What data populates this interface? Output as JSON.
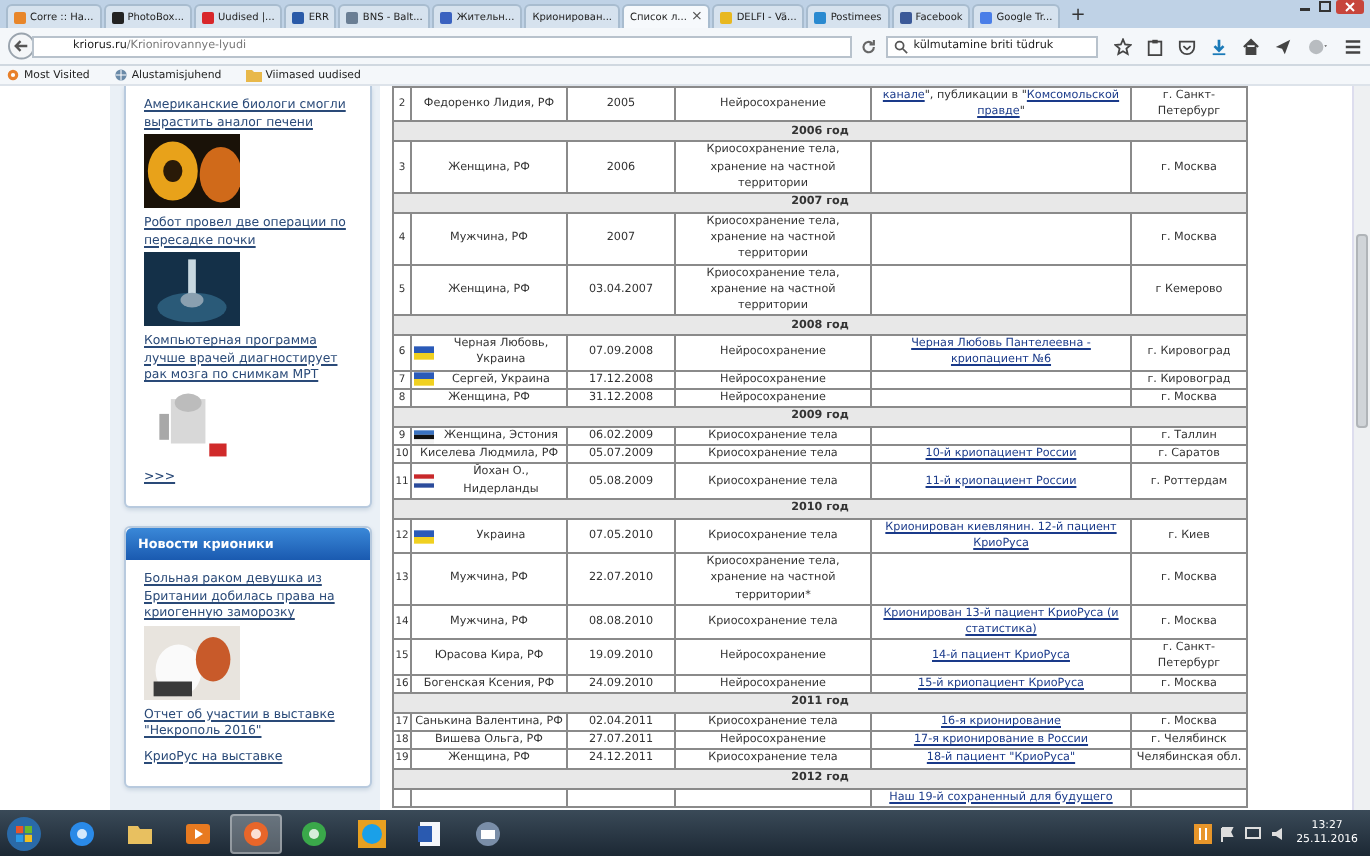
{
  "tabs": [
    {
      "label": "Corre :: На...",
      "selected": false,
      "color": "#e8862a"
    },
    {
      "label": "PhotoBox...",
      "selected": false,
      "color": "#222222"
    },
    {
      "label": "Uudised |...",
      "selected": false,
      "color": "#d8262a"
    },
    {
      "label": "ERR",
      "selected": false,
      "color": "#2a5aa8"
    },
    {
      "label": "BNS - Balt...",
      "selected": false,
      "color": "#6a7e94"
    },
    {
      "label": "Жительн...",
      "selected": false,
      "color": "#3a62c0"
    },
    {
      "label": "Крионирован...",
      "selected": false
    },
    {
      "label": "Список л...",
      "selected": true
    },
    {
      "label": "DELFI - Vä...",
      "selected": false,
      "color": "#e8b820"
    },
    {
      "label": "Postimees",
      "selected": false,
      "color": "#2a8ad0"
    },
    {
      "label": "Facebook",
      "selected": false,
      "color": "#3b5998"
    },
    {
      "label": "Google Tr...",
      "selected": false,
      "color": "#4a7ee8"
    }
  ],
  "tab_close": "×",
  "new_tab": "+",
  "address": {
    "host": "kriorus.ru",
    "path": "/Krionirovannye-lyudi"
  },
  "search": {
    "value": "külmutamine briti tüdruk"
  },
  "bookmarks": [
    {
      "label": "Most Visited",
      "kind": "gear"
    },
    {
      "label": "Alustamisjuhend",
      "kind": "globe"
    },
    {
      "label": "Viimased uudised",
      "kind": "folder"
    }
  ],
  "sidebar": {
    "panels": [
      {
        "items": [
          {
            "text": "Американские биологи смогли вырастить аналог печени",
            "picture": true
          },
          {
            "text": "Робот провел две операции по пересадке почки",
            "picture": true
          },
          {
            "text": "Компьютерная программа лучше врачей диагностирует рак мозга по снимкам МРТ",
            "picture": true
          },
          {
            "text": ">>>",
            "picture": false
          }
        ]
      },
      {
        "title": "Новости крионики",
        "items": [
          {
            "text": "Больная раком девушка из Британии добилась права на криогенную заморозку",
            "picture": true
          },
          {
            "text": "Отчет об участии в выставке \"Некрополь 2016\"",
            "picture": false
          },
          {
            "text": "КриоРус на выставке",
            "picture": false
          }
        ]
      }
    ]
  },
  "table": {
    "rows": [
      {
        "kind": "person",
        "num": "2",
        "flag": null,
        "name": "Федоренко Лидия, РФ",
        "date": "2005",
        "type": "Нейросохранение",
        "note": [
          {
            "text": "канале",
            "linked": true
          },
          {
            "text": "\", публикации в \"",
            "linked": false
          },
          {
            "text": "Комсомольской правде",
            "linked": true
          },
          {
            "text": "\"",
            "linked": false
          }
        ],
        "city": "г. Санкт-Петербург"
      },
      {
        "kind": "year",
        "label": "2006 год"
      },
      {
        "kind": "person",
        "num": "3",
        "flag": null,
        "name": "Женщина, РФ",
        "date": "2006",
        "type": "Криосохранение тела, хранение на частной территории",
        "note": [],
        "city": "г. Москва"
      },
      {
        "kind": "year",
        "label": "2007 год"
      },
      {
        "kind": "person",
        "num": "4",
        "flag": null,
        "name": "Мужчина, РФ",
        "date": "2007",
        "type": "Криосохранение тела, хранение на частной территории",
        "note": [],
        "city": "г. Москва"
      },
      {
        "kind": "person",
        "num": "5",
        "flag": null,
        "name": "Женщина, РФ",
        "date": "03.04.2007",
        "type": "Криосохранение тела, хранение на частной территории",
        "note": [],
        "city": "г Кемерово"
      },
      {
        "kind": "year",
        "label": "2008 год"
      },
      {
        "kind": "person",
        "num": "6",
        "flag": {
          "kind": "ua"
        },
        "name": "Черная Любовь, Украина",
        "date": "07.09.2008",
        "type": "Нейросохранение",
        "note": [
          {
            "text": "Черная Любовь Пантелеевна - криопациент №6",
            "linked": true
          }
        ],
        "city": "г. Кировоград"
      },
      {
        "kind": "person",
        "num": "7",
        "flag": {
          "kind": "ua"
        },
        "name": "Сергей, Украина",
        "date": "17.12.2008",
        "type": "Нейросохранение",
        "note": [],
        "city": "г. Кировоград"
      },
      {
        "kind": "person",
        "num": "8",
        "flag": null,
        "name": "Женщина, РФ",
        "date": "31.12.2008",
        "type": "Нейросохранение",
        "note": [],
        "city": "г. Москва"
      },
      {
        "kind": "year",
        "label": "2009 год"
      },
      {
        "kind": "person",
        "num": "9",
        "flag": {
          "kind": "ee"
        },
        "name": "Женщина, Эстония",
        "date": "06.02.2009",
        "type": "Криосохранение тела",
        "note": [],
        "city": "г. Таллин"
      },
      {
        "kind": "person",
        "num": "10",
        "flag": null,
        "name": "Киселева Людмила, РФ",
        "date": "05.07.2009",
        "type": "Криосохранение тела",
        "note": [
          {
            "text": "10-й криопациент России",
            "linked": true
          }
        ],
        "city": "г. Саратов"
      },
      {
        "kind": "person",
        "num": "11",
        "flag": {
          "kind": "nl"
        },
        "name": "Йохан О., Нидерланды",
        "date": "05.08.2009",
        "type": "Криосохранение тела",
        "note": [
          {
            "text": "11-й криопациент России",
            "linked": true
          }
        ],
        "city": "г. Роттердам"
      },
      {
        "kind": "year",
        "label": "2010 год"
      },
      {
        "kind": "person",
        "num": "12",
        "flag": {
          "kind": "ua"
        },
        "name": "Украина",
        "date": "07.05.2010",
        "type": "Криосохранение тела",
        "note": [
          {
            "text": "Крионирован киевлянин. 12-й пациент КриоРуса",
            "linked": true
          }
        ],
        "city": "г. Киев"
      },
      {
        "kind": "person",
        "num": "13",
        "flag": null,
        "name": "Мужчина, РФ",
        "date": "22.07.2010",
        "type": "Криосохранение тела, хранение на частной территории*",
        "note": [],
        "city": "г. Москва"
      },
      {
        "kind": "person",
        "num": "14",
        "flag": null,
        "name": "Мужчина, РФ",
        "date": "08.08.2010",
        "type": "Криосохранение тела",
        "note": [
          {
            "text": "Крионирован 13-й пациент КриоРуса (и статистика)",
            "linked": true
          }
        ],
        "city": "г. Москва"
      },
      {
        "kind": "person",
        "num": "15",
        "flag": null,
        "name": "Юрасова Кира, РФ",
        "date": "19.09.2010",
        "type": "Нейросохранение",
        "note": [
          {
            "text": "14-й пациент КриоРуса",
            "linked": true
          }
        ],
        "city": "г. Санкт-Петербург"
      },
      {
        "kind": "person",
        "num": "16",
        "flag": null,
        "name": "Богенская Ксения, РФ",
        "date": "24.09.2010",
        "type": "Нейросохранение",
        "note": [
          {
            "text": "15-й криопациент КриоРуса",
            "linked": true
          }
        ],
        "city": "г. Москва"
      },
      {
        "kind": "year",
        "label": "2011 год"
      },
      {
        "kind": "person",
        "num": "17",
        "flag": null,
        "name": "Санькина Валентина, РФ",
        "date": "02.04.2011",
        "type": "Криосохранение тела",
        "note": [
          {
            "text": "16-я крионирование",
            "linked": true
          }
        ],
        "city": "г. Москва"
      },
      {
        "kind": "person",
        "num": "18",
        "flag": null,
        "name": "Вишева Ольга, РФ",
        "date": "27.07.2011",
        "type": "Нейросохранение",
        "note": [
          {
            "text": "17-я крионирование в России",
            "linked": true
          }
        ],
        "city": "г. Челябинск"
      },
      {
        "kind": "person",
        "num": "19",
        "flag": null,
        "name": "Женщина, РФ",
        "date": "24.12.2011",
        "type": "Криосохранение тела",
        "note": [
          {
            "text": "18-й пациент \"КриоРуса\"",
            "linked": true
          }
        ],
        "city": "Челябинская обл."
      },
      {
        "kind": "year",
        "label": "2012 год"
      },
      {
        "kind": "person",
        "note": [
          {
            "text": "Наш 19-й сохраненный для будущего",
            "linked": true
          }
        ]
      }
    ]
  },
  "taskbar": {
    "apps": [
      {
        "kind": "ie",
        "selected": false
      },
      {
        "kind": "folder",
        "selected": false
      },
      {
        "kind": "media",
        "selected": false
      },
      {
        "kind": "firefox",
        "selected": true
      },
      {
        "kind": "chrome",
        "selected": false
      },
      {
        "kind": "skype",
        "selected": false
      },
      {
        "kind": "word",
        "selected": false
      },
      {
        "kind": "mail",
        "selected": false
      }
    ],
    "time": "13:27",
    "date": "25.11.2016"
  }
}
